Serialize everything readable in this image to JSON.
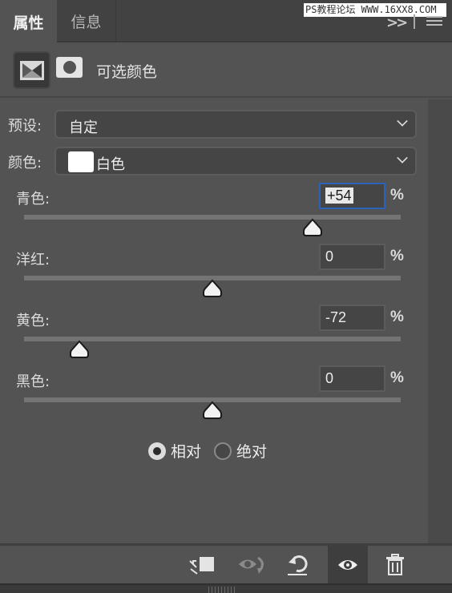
{
  "tabs": [
    {
      "label": "属性",
      "active": true
    },
    {
      "label": "信息",
      "active": false
    }
  ],
  "watermark": "PS教程论坛 WWW.16XX8.COM",
  "header": {
    "title": "可选颜色",
    "mode_icon": "adjustment-layer-icon",
    "mask_icon": "layer-mask-icon"
  },
  "preset": {
    "label": "预设:",
    "value": "自定"
  },
  "color": {
    "label": "颜色:",
    "value": "白色",
    "swatch": "#ffffff"
  },
  "sliders": [
    {
      "label": "青色:",
      "value": "+54",
      "numeric": 54,
      "unit": "%",
      "focused": true
    },
    {
      "label": "洋红:",
      "value": "0",
      "numeric": 0,
      "unit": "%",
      "focused": false
    },
    {
      "label": "黄色:",
      "value": "-72",
      "numeric": -72,
      "unit": "%",
      "focused": false
    },
    {
      "label": "黑色:",
      "value": "0",
      "numeric": 0,
      "unit": "%",
      "focused": false
    }
  ],
  "slider_range": [
    -100,
    100
  ],
  "method": {
    "options": [
      {
        "label": "相对",
        "checked": true
      },
      {
        "label": "绝对",
        "checked": false
      }
    ]
  },
  "footer": {
    "buttons": [
      {
        "name": "clip-to-layer",
        "icon": "clip-to-layer-icon"
      },
      {
        "name": "view-previous-state",
        "icon": "eye-previous-icon"
      },
      {
        "name": "reset",
        "icon": "reset-icon"
      },
      {
        "name": "toggle-visibility",
        "icon": "eye-icon",
        "active": true
      },
      {
        "name": "delete",
        "icon": "trash-icon"
      }
    ]
  },
  "colors": {
    "focus": "#2a63b8",
    "panel_bg": "#535353",
    "tab_bg": "#424242"
  }
}
